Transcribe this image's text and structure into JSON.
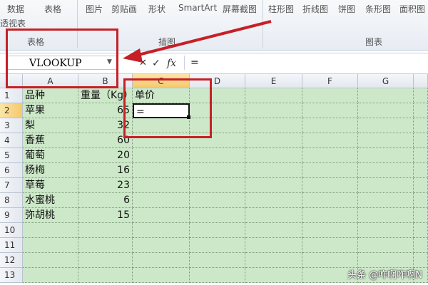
{
  "ribbon": {
    "top_items": [
      "数据",
      "表格",
      "图片",
      "剪贴画",
      "形状",
      "SmartArt",
      "屏幕截图",
      "柱形图",
      "折线图",
      "饼图",
      "条形图",
      "面积图"
    ],
    "top_left_sub": "透视表",
    "groups": {
      "tables": "表格",
      "illustrations": "插图",
      "charts": "图表"
    }
  },
  "formula_bar": {
    "name_box": "VLOOKUP",
    "cancel_icon": "✕",
    "enter_icon": "✓",
    "fx_label": "fx",
    "formula": "="
  },
  "sheet": {
    "columns": [
      "A",
      "B",
      "C",
      "D",
      "E",
      "F",
      "G"
    ],
    "row_numbers": [
      "1",
      "2",
      "3",
      "4",
      "5",
      "6",
      "7",
      "8",
      "9",
      "10",
      "11",
      "12",
      "13"
    ],
    "active_column": "C",
    "active_row": "2",
    "rows": [
      {
        "a": "品种",
        "b": "重量（Kg）",
        "c": "单价"
      },
      {
        "a": "苹果",
        "b": "65",
        "c": "="
      },
      {
        "a": "梨",
        "b": "32",
        "c": ""
      },
      {
        "a": "香蕉",
        "b": "60",
        "c": ""
      },
      {
        "a": "葡萄",
        "b": "20",
        "c": ""
      },
      {
        "a": "杨梅",
        "b": "16",
        "c": ""
      },
      {
        "a": "草莓",
        "b": "23",
        "c": ""
      },
      {
        "a": "水蜜桃",
        "b": "6",
        "c": ""
      },
      {
        "a": "弥胡桃",
        "b": "15",
        "c": ""
      }
    ]
  },
  "watermark": "头条 @咋啊咋啊N",
  "colors": {
    "cell_fill": "#cde8c9",
    "highlight": "#c62026",
    "active_header": "#f5c969"
  }
}
